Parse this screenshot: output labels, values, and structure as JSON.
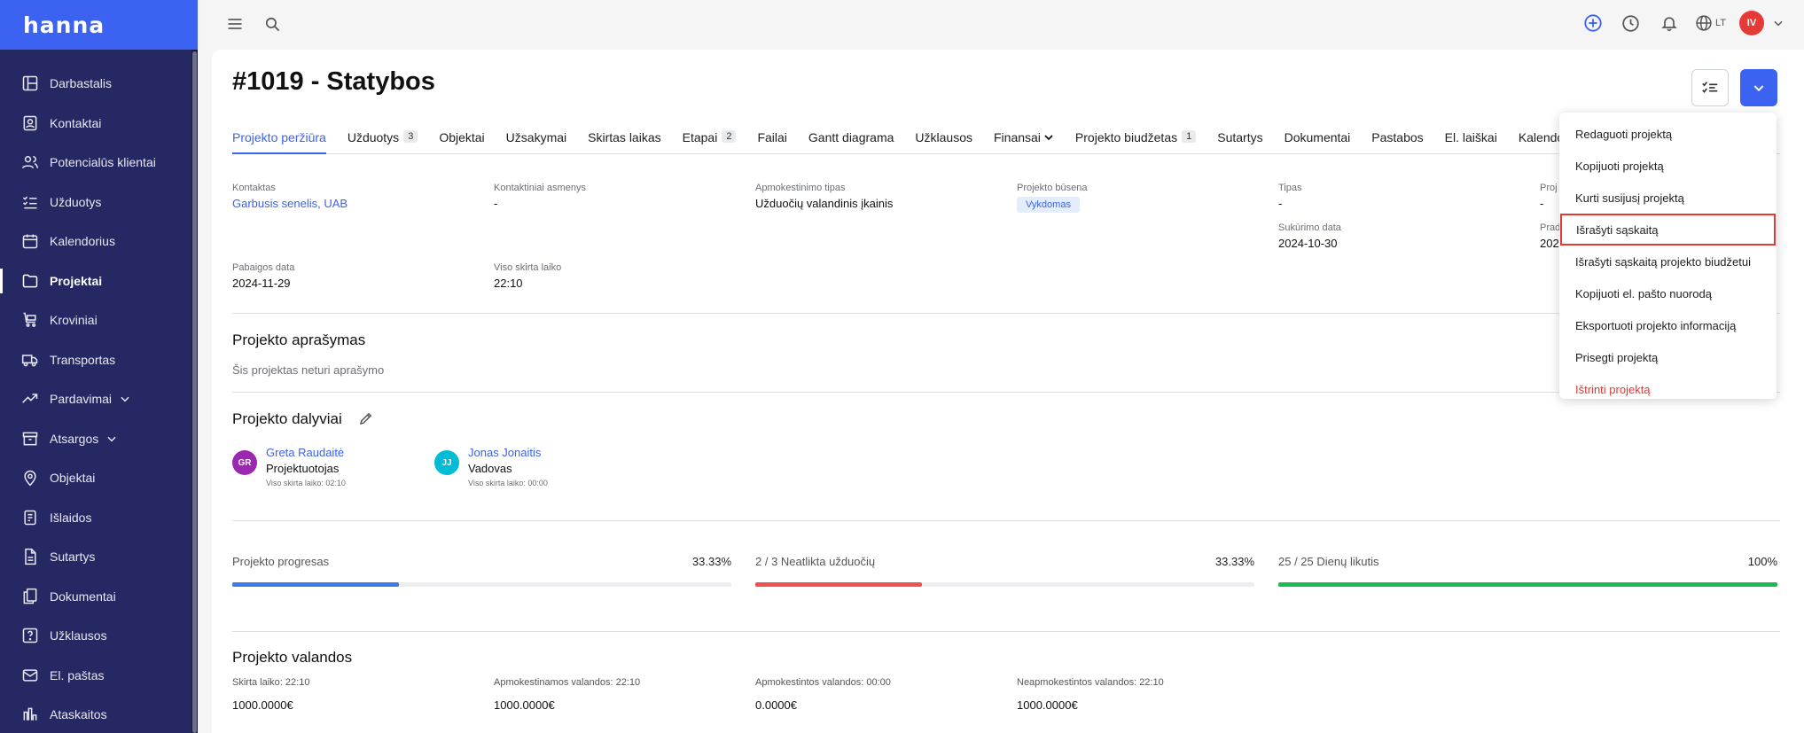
{
  "app": {
    "logo": "hanna"
  },
  "sidebar": {
    "items": [
      {
        "label": "Darbastalis",
        "icon": "dashboard-icon"
      },
      {
        "label": "Kontaktai",
        "icon": "contacts-icon"
      },
      {
        "label": "Potencialūs klientai",
        "icon": "users-icon"
      },
      {
        "label": "Užduotys",
        "icon": "tasks-icon"
      },
      {
        "label": "Kalendorius",
        "icon": "calendar-icon"
      },
      {
        "label": "Projektai",
        "icon": "folder-icon",
        "active": true
      },
      {
        "label": "Kroviniai",
        "icon": "cart-icon"
      },
      {
        "label": "Transportas",
        "icon": "truck-icon"
      },
      {
        "label": "Pardavimai",
        "icon": "trending-icon",
        "expandable": true
      },
      {
        "label": "Atsargos",
        "icon": "archive-icon",
        "expandable": true
      },
      {
        "label": "Objektai",
        "icon": "map-pin-icon"
      },
      {
        "label": "Išlaidos",
        "icon": "receipt-icon"
      },
      {
        "label": "Sutartys",
        "icon": "document-icon"
      },
      {
        "label": "Dokumentai",
        "icon": "documents-icon"
      },
      {
        "label": "Užklausos",
        "icon": "question-icon"
      },
      {
        "label": "El. paštas",
        "icon": "mail-icon"
      },
      {
        "label": "Ataskaitos",
        "icon": "reports-icon"
      }
    ]
  },
  "topbar": {
    "lang": "LT",
    "user_initials": "IV"
  },
  "page": {
    "title": "#1019 - Statybos",
    "tabs": [
      {
        "label": "Projekto peržiūra",
        "active": true
      },
      {
        "label": "Užduotys",
        "badge": "3"
      },
      {
        "label": "Objektai"
      },
      {
        "label": "Užsakymai"
      },
      {
        "label": "Skirtas laikas"
      },
      {
        "label": "Etapai",
        "badge": "2"
      },
      {
        "label": "Failai"
      },
      {
        "label": "Gantt diagrama"
      },
      {
        "label": "Užklausos"
      },
      {
        "label": "Finansai",
        "dropdown": true
      },
      {
        "label": "Projekto biudžetas",
        "badge": "1"
      },
      {
        "label": "Sutartys"
      },
      {
        "label": "Dokumentai"
      },
      {
        "label": "Pastabos"
      },
      {
        "label": "El. laiškai"
      },
      {
        "label": "Kalendor"
      }
    ]
  },
  "details": {
    "contact_label": "Kontaktas",
    "contact_value": "Garbusis senelis, UAB",
    "persons_label": "Kontaktiniai asmenys",
    "persons_value": "-",
    "billing_label": "Apmokestinimo tipas",
    "billing_value": "Užduočių valandinis įkainis",
    "status_label": "Projekto būsena",
    "status_value": "Vykdomas",
    "type_label": "Tipas",
    "type_value": "-",
    "created_label": "Sukūrimo data",
    "created_value": "2024-10-30",
    "cut_label1": "Proj",
    "cut_value1": "-",
    "cut_label2": "Prad",
    "cut_value2": "202",
    "end_label": "Pabaigos data",
    "end_value": "2024-11-29",
    "total_label": "Viso skirta laiko",
    "total_value": "22:10"
  },
  "description": {
    "title": "Projekto aprašymas",
    "empty_text": "Šis projektas neturi aprašymo"
  },
  "participants": {
    "title": "Projekto dalyviai",
    "members": [
      {
        "initials": "GR",
        "name": "Greta Raudaitė",
        "role": "Projektuotojas",
        "hours": "Viso skirta laiko: 02:10",
        "color": "#9c27b0"
      },
      {
        "initials": "JJ",
        "name": "Jonas Jonaitis",
        "role": "Vadovas",
        "hours": "Viso skirta laiko: 00:00",
        "color": "#00bcd4"
      }
    ]
  },
  "progress": [
    {
      "label": "Projekto progresas",
      "value": "33.33%",
      "fraction": 0.3333,
      "color": "#3b7be8"
    },
    {
      "label": "2 / 3 Neatlikta užduočių",
      "value": "33.33%",
      "fraction": 0.3333,
      "color": "#ef5350"
    },
    {
      "label": "25 / 25 Dienų likutis",
      "value": "100%",
      "fraction": 1.0,
      "color": "#1db954"
    }
  ],
  "hours": {
    "title": "Projekto valandos",
    "cols": [
      {
        "label": "Skirta laiko: 22:10",
        "amount": "1000.0000€"
      },
      {
        "label": "Apmokestinamos valandos: 22:10",
        "amount": "1000.0000€"
      },
      {
        "label": "Apmokestintos valandos: 00:00",
        "amount": "0.0000€"
      },
      {
        "label": "Neapmokestintos valandos: 22:10",
        "amount": "1000.0000€"
      }
    ]
  },
  "menu": {
    "items": [
      {
        "label": "Redaguoti projektą"
      },
      {
        "label": "Kopijuoti projektą"
      },
      {
        "label": "Kurti susijusį projektą"
      },
      {
        "label": "Išrašyti sąskaitą",
        "highlight": true
      },
      {
        "label": "Išrašyti sąskaitą projekto biudžetui"
      },
      {
        "label": "Kopijuoti el. pašto nuorodą"
      },
      {
        "label": "Eksportuoti projekto informaciją"
      },
      {
        "label": "Prisegti projektą"
      },
      {
        "label": "Ištrinti projektą",
        "danger": true
      }
    ]
  },
  "colors": {
    "accent": "#3b62f0",
    "sidebar": "#262863",
    "danger": "#e53935"
  }
}
